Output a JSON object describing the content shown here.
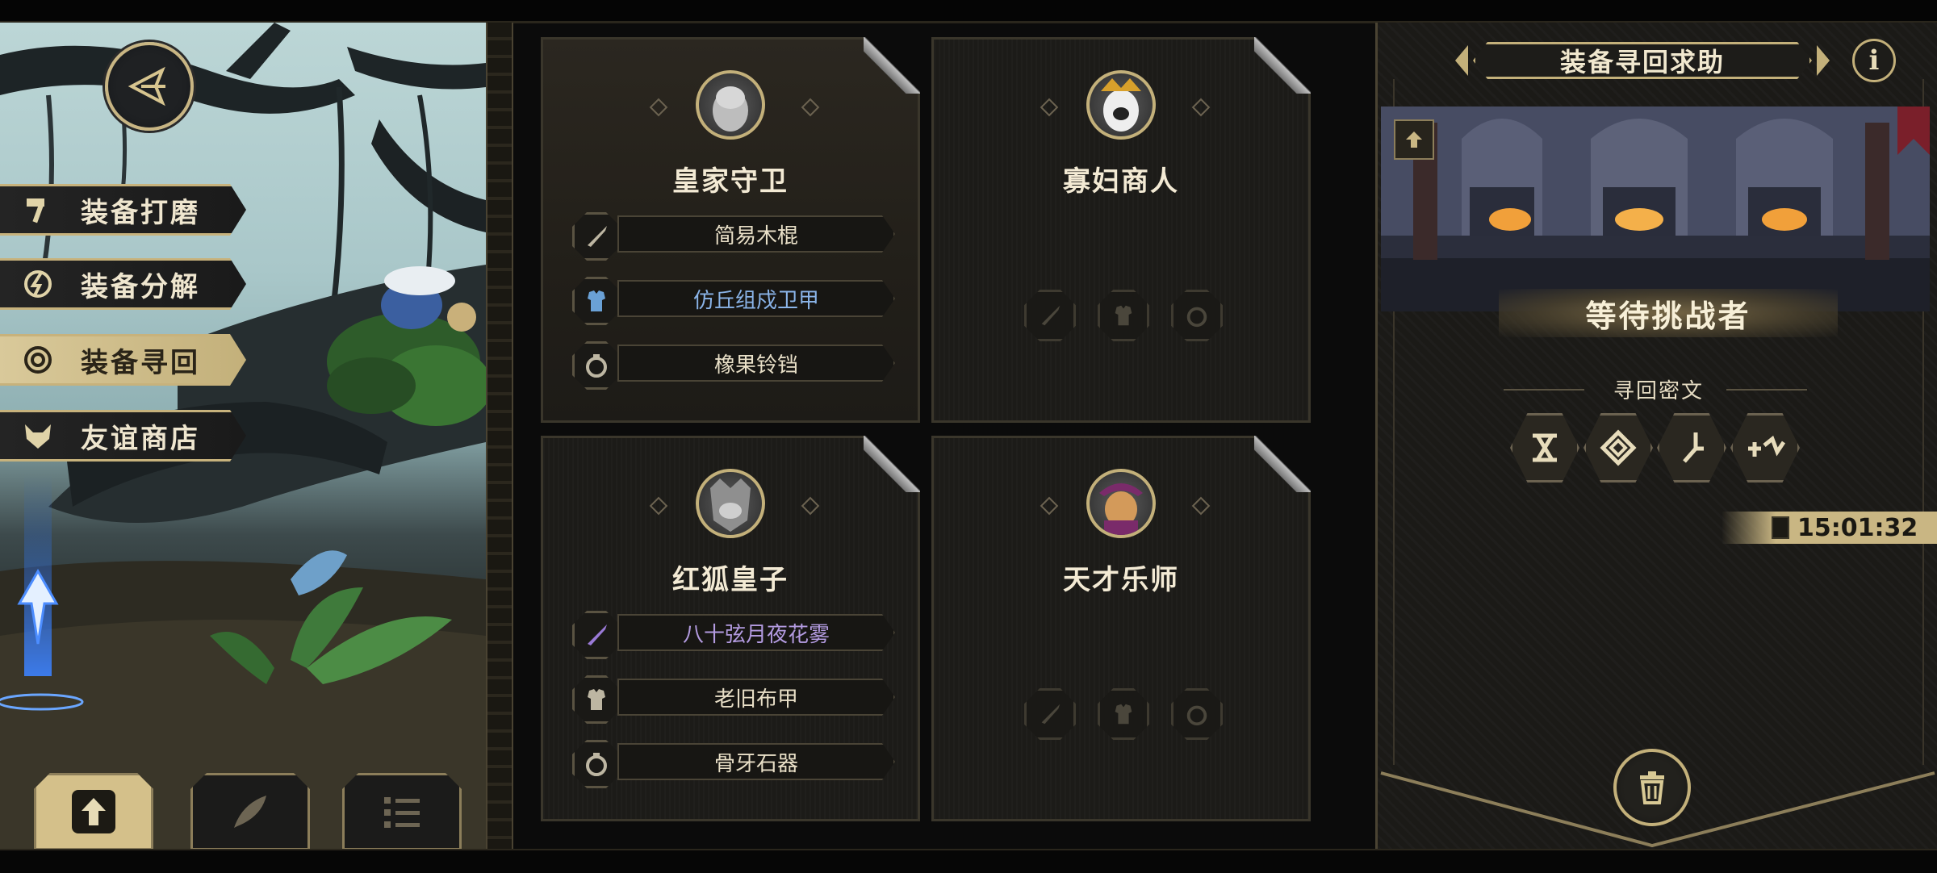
{
  "left_menu": {
    "items": [
      {
        "label": "装备打磨",
        "icon": "hammer-icon",
        "active": false
      },
      {
        "label": "装备分解",
        "icon": "disassemble-icon",
        "active": false
      },
      {
        "label": "装备寻回",
        "icon": "spiral-icon",
        "active": true
      },
      {
        "label": "友谊商店",
        "icon": "fox-icon",
        "active": false
      }
    ]
  },
  "bottom_tabs": [
    {
      "icon": "upload-icon",
      "active": true
    },
    {
      "icon": "feather-icon",
      "active": false
    },
    {
      "icon": "list-icon",
      "active": false
    }
  ],
  "cards": [
    {
      "name": "皇家守卫",
      "slots": [
        {
          "label": "简易木棍",
          "icon": "sword-icon",
          "rarity": "common"
        },
        {
          "label": "仿丘组戍卫甲",
          "icon": "armor-icon",
          "rarity": "blue"
        },
        {
          "label": "橡果铃铛",
          "icon": "ring-icon",
          "rarity": "common"
        }
      ]
    },
    {
      "name": "寡妇商人",
      "slots": []
    },
    {
      "name": "红狐皇子",
      "slots": [
        {
          "label": "八十弦月夜花雾",
          "icon": "sword-icon",
          "rarity": "purple"
        },
        {
          "label": "老旧布甲",
          "icon": "armor-icon",
          "rarity": "common"
        },
        {
          "label": "骨牙石器",
          "icon": "ring-icon",
          "rarity": "common"
        }
      ]
    },
    {
      "name": "天才乐师",
      "slots": []
    }
  ],
  "right_panel": {
    "title": "装备寻回求助",
    "info_icon": "info-icon",
    "status_banner": "等待挑战者",
    "cipher_label": "寻回密文",
    "runes": [
      "rune-1-icon",
      "rune-2-icon",
      "rune-3-icon",
      "rune-4-icon"
    ],
    "timer": "15:01:32"
  },
  "colors": {
    "gold": "#c3b07a",
    "blue_rarity": "#8ab4e8",
    "purple_rarity": "#b39be0"
  }
}
